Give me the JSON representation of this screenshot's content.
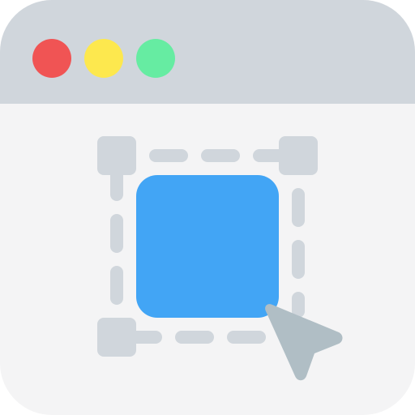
{
  "window": {
    "background_color": "#f4f4f5",
    "titlebar_color": "#d0d6dc"
  },
  "titlebar": {
    "buttons": [
      {
        "name": "close-button",
        "color": "#f05454"
      },
      {
        "name": "minimize-button",
        "color": "#fde84e"
      },
      {
        "name": "maximize-button",
        "color": "#66eca2"
      }
    ]
  },
  "selection": {
    "handle_color": "#d0d6dc",
    "dash_color": "#d0d6dc",
    "shape_color": "#42a5f5",
    "shape_icon": "rounded-square-shape"
  },
  "cursor": {
    "icon": "arrow-cursor-icon",
    "color": "#b0bec5"
  }
}
